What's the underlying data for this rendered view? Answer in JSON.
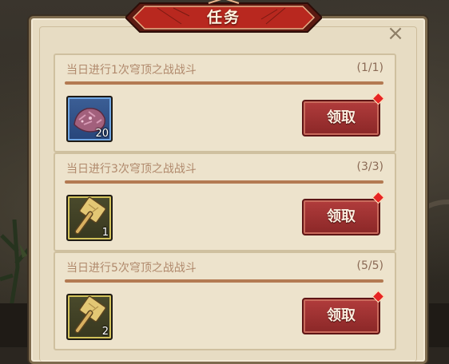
{
  "window": {
    "title": "任务",
    "close_label": "×"
  },
  "tasks": [
    {
      "title": "当日进行1次穹顶之战战斗",
      "progress": "(1/1)",
      "progress_fraction": 1.0,
      "reward": {
        "icon": "crystal-ore-icon",
        "count": "20",
        "frame_color": "#6fa6e3"
      },
      "claim_label": "领取",
      "notification": true
    },
    {
      "title": "当日进行3次穹顶之战战斗",
      "progress": "(3/3)",
      "progress_fraction": 1.0,
      "reward": {
        "icon": "hammer-icon",
        "count": "1",
        "frame_color": "#d2c25a"
      },
      "claim_label": "领取",
      "notification": true
    },
    {
      "title": "当日进行5次穹顶之战战斗",
      "progress": "(5/5)",
      "progress_fraction": 1.0,
      "reward": {
        "icon": "hammer-icon",
        "count": "2",
        "frame_color": "#d2c25a"
      },
      "claim_label": "领取",
      "notification": true
    }
  ],
  "colors": {
    "accent_red": "#8a2727",
    "parchment": "#e7dcc3",
    "notification": "#e62424"
  }
}
